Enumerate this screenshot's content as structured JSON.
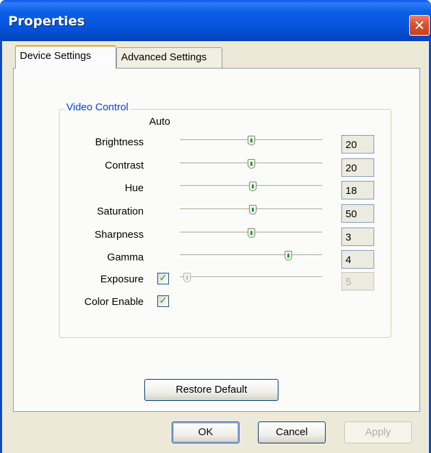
{
  "window": {
    "title": "Properties",
    "close_glyph": "✕"
  },
  "tabs": [
    {
      "label": "Device Settings",
      "active": true
    },
    {
      "label": "Advanced Settings",
      "active": false
    }
  ],
  "video_control": {
    "group_title": "Video Control",
    "auto_header": "Auto",
    "rows": [
      {
        "label": "Brightness",
        "value": "20",
        "slider_fraction": 0.5,
        "auto_checkbox": false,
        "enabled": true
      },
      {
        "label": "Contrast",
        "value": "20",
        "slider_fraction": 0.5,
        "auto_checkbox": false,
        "enabled": true
      },
      {
        "label": "Hue",
        "value": "18",
        "slider_fraction": 0.51,
        "auto_checkbox": false,
        "enabled": true
      },
      {
        "label": "Saturation",
        "value": "50",
        "slider_fraction": 0.51,
        "auto_checkbox": false,
        "enabled": true
      },
      {
        "label": "Sharpness",
        "value": "3",
        "slider_fraction": 0.5,
        "auto_checkbox": false,
        "enabled": true
      },
      {
        "label": "Gamma",
        "value": "4",
        "slider_fraction": 0.76,
        "auto_checkbox": false,
        "enabled": true
      },
      {
        "label": "Exposure",
        "value": "5",
        "slider_fraction": 0.03,
        "auto_checkbox": true,
        "auto_checked": true,
        "enabled": false
      },
      {
        "label": "Color Enable",
        "checked": true
      }
    ]
  },
  "buttons": {
    "restore_default": "Restore Default",
    "ok": "OK",
    "cancel": "Cancel",
    "apply": "Apply"
  },
  "colors": {
    "title_bar": "#0a58e8",
    "dialog_bg": "#ece9d8",
    "group_title": "#0046d5",
    "close_button": "#d9512d"
  }
}
